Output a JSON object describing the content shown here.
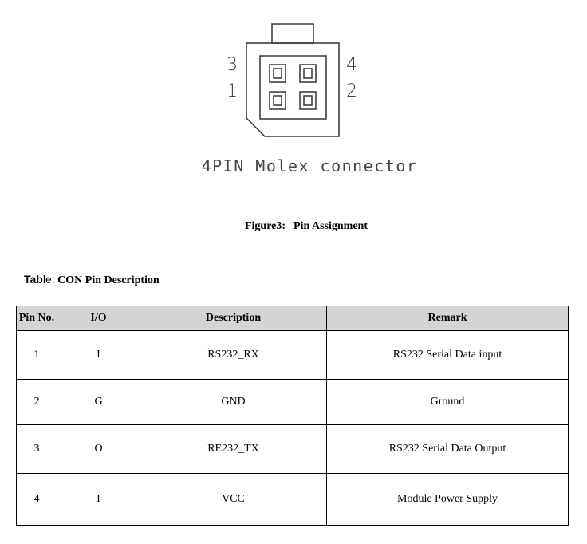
{
  "figure": {
    "pin_labels": {
      "p1": "1",
      "p2": "2",
      "p3": "3",
      "p4": "4"
    },
    "connector_caption": "4PIN Molex connector",
    "caption_label": "Figure3",
    "caption_sep": ":",
    "caption_title": "Pin Assignment"
  },
  "table_caption": {
    "prefix_bold": "Tab",
    "prefix_normal": "le:",
    "title": "CON Pin Description"
  },
  "table": {
    "headers": [
      "Pin No.",
      "I/O",
      "Description",
      "Remark"
    ],
    "rows": [
      [
        "1",
        "I",
        "RS232_RX",
        "RS232 Serial Data input"
      ],
      [
        "2",
        "G",
        "GND",
        "Ground"
      ],
      [
        "3",
        "O",
        "RE232_TX",
        "RS232 Serial Data Output"
      ],
      [
        "4",
        "I",
        "VCC",
        "Module Power Supply"
      ]
    ]
  }
}
